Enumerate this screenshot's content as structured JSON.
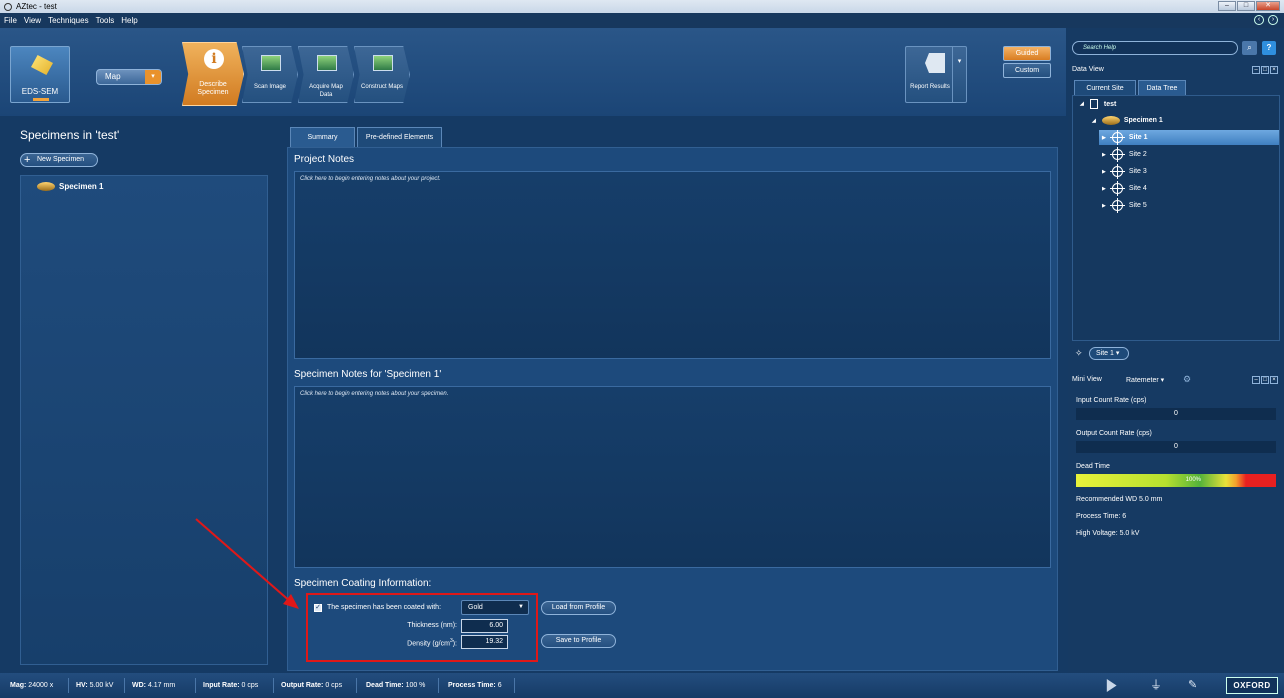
{
  "window": {
    "title": "AZtec - test"
  },
  "menu": [
    "File",
    "View",
    "Techniques",
    "Tools",
    "Help"
  ],
  "ribbon": {
    "eds_label": "EDS-SEM",
    "mode_dropdown": "Map",
    "steps": [
      {
        "label": "Describe Specimen",
        "active": true
      },
      {
        "label": "Scan Image",
        "active": false
      },
      {
        "label": "Acquire Map Data",
        "active": false
      },
      {
        "label": "Construct Maps",
        "active": false
      }
    ],
    "report": "Report Results",
    "guided": "Guided",
    "custom": "Custom"
  },
  "left": {
    "title": "Specimens in 'test'",
    "new_specimen": "New Specimen",
    "specimens": [
      "Specimen 1"
    ]
  },
  "center": {
    "tabs": [
      "Summary",
      "Pre-defined Elements"
    ],
    "project_notes_title": "Project Notes",
    "project_notes_placeholder": "Click here to begin entering notes about your project.",
    "specimen_notes_title": "Specimen Notes for 'Specimen 1'",
    "specimen_notes_placeholder": "Click here to begin entering notes about your specimen.",
    "coating": {
      "title": "Specimen Coating Information:",
      "coated_label": "The specimen has been coated with:",
      "coated_checked": true,
      "material": "Gold",
      "thickness_label": "Thickness (nm):",
      "thickness": "6.00",
      "density_label_pre": "Density (g/cm",
      "density_label_sup": "3",
      "density_label_post": "):",
      "density": "19.32",
      "load_btn": "Load from Profile",
      "save_btn": "Save to Profile"
    }
  },
  "right": {
    "search_placeholder": "Search Help",
    "data_view": "Data View",
    "tabs": [
      "Current Site",
      "Data Tree"
    ],
    "tree": {
      "project": "test",
      "specimen": "Specimen 1",
      "sites": [
        "Site 1",
        "Site 2",
        "Site 3",
        "Site 4",
        "Site 5"
      ]
    },
    "site_selector": "Site 1",
    "mini_view": "Mini View",
    "ratemeter": "Ratemeter",
    "input_rate_label": "Input Count Rate (cps)",
    "input_rate": "0",
    "output_rate_label": "Output Count Rate (cps)",
    "output_rate": "0",
    "dead_time_label": "Dead Time",
    "dead_time": "100%",
    "info": [
      "Recommended WD 5.0 mm",
      "Process Time: 6",
      "High Voltage: 5.0 kV"
    ]
  },
  "status": {
    "mag": {
      "label": "Mag:",
      "value": "24000 x"
    },
    "hv": {
      "label": "HV:",
      "value": "5.00 kV"
    },
    "wd": {
      "label": "WD:",
      "value": "4.17 mm"
    },
    "input": {
      "label": "Input Rate:",
      "value": "0 cps"
    },
    "output": {
      "label": "Output Rate:",
      "value": "0 cps"
    },
    "dead": {
      "label": "Dead Time:",
      "value": "100 %"
    },
    "process": {
      "label": "Process Time:",
      "value": "6"
    },
    "brand": "OXFORD"
  },
  "colors": {
    "accent": "#e9922c",
    "highlight": "#e01818",
    "background": "#153a64"
  }
}
